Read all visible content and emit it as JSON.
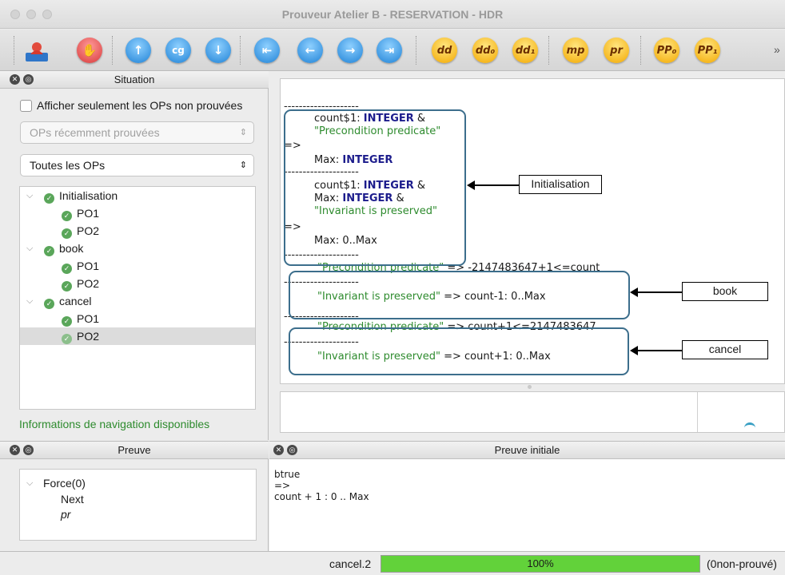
{
  "window": {
    "title": "Prouveur Atelier B - RESERVATION - HDR"
  },
  "toolbar": {
    "buttons": [
      {
        "name": "user-icon",
        "label": ""
      },
      {
        "name": "stop-icon",
        "label": ""
      },
      {
        "name": "up-icon",
        "label": "↑"
      },
      {
        "name": "cg",
        "label": "cg"
      },
      {
        "name": "down-icon",
        "label": "↓"
      },
      {
        "name": "back-first-icon",
        "label": "⇤"
      },
      {
        "name": "back-icon",
        "label": "←"
      },
      {
        "name": "forward-icon",
        "label": "→"
      },
      {
        "name": "forward-last-icon",
        "label": "⇥"
      },
      {
        "name": "dd",
        "label": "dd"
      },
      {
        "name": "dd0",
        "label": "dd₀"
      },
      {
        "name": "dd1",
        "label": "dd₁"
      },
      {
        "name": "mp",
        "label": "mp"
      },
      {
        "name": "pr",
        "label": "pr"
      },
      {
        "name": "pp0",
        "label": "PP₀"
      },
      {
        "name": "pp1",
        "label": "PP₁"
      }
    ],
    "overflow": "»"
  },
  "situation": {
    "title": "Situation",
    "checkbox_label": "Afficher seulement les OPs non prouvées",
    "filter_select": "OPs récemment prouvées",
    "ops_select": "Toutes les OPs",
    "tree": [
      {
        "label": "Initialisation",
        "children": [
          "PO1",
          "PO2"
        ]
      },
      {
        "label": "book",
        "children": [
          "PO1",
          "PO2"
        ]
      },
      {
        "label": "cancel",
        "children": [
          "PO1",
          "PO2"
        ]
      }
    ],
    "nav_info": "Informations de navigation disponibles"
  },
  "goal": {
    "sep": "--------------------",
    "init_1": "count$1: ",
    "INTEGER": "INTEGER",
    "amp": " &",
    "precondition": "\"Precondition predicate\"",
    "implies": "=>",
    "max": "Max: ",
    "init_max_int": "Max: ",
    "invariant": "\"Invariant is preserved\"",
    "max_range": "Max: 0..Max",
    "book_pre_rhs": " => -2147483647+1<=count",
    "book_inv_rhs": " => count-1: 0..Max",
    "cancel_pre_rhs": " => count+1<=2147483647",
    "cancel_inv_rhs": " => count+1: 0..Max"
  },
  "annotations": {
    "initialisation": "Initialisation",
    "book": "book",
    "cancel": "cancel"
  },
  "proof": {
    "title": "Preuve",
    "root": "Force(0)",
    "child_next": "Next",
    "child_pr": "pr"
  },
  "initial_proof": {
    "title": "Preuve initiale",
    "line1": "btrue",
    "line2": "=>",
    "line3": "count + 1 : 0 .. Max"
  },
  "status": {
    "po": "cancel.2",
    "progress_label": "100%",
    "progress": 1.0,
    "unproved": "(0non-prouvé)"
  }
}
